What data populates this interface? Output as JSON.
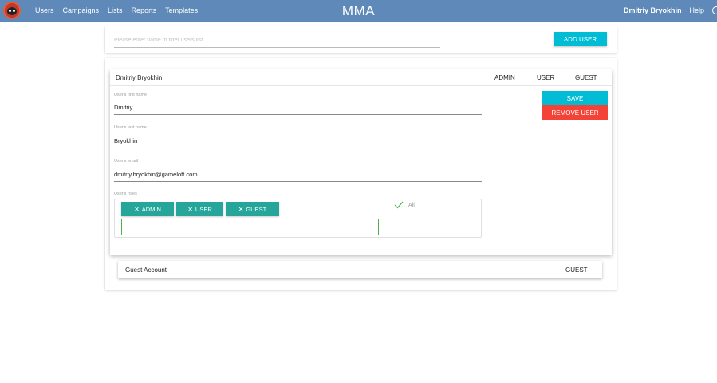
{
  "header": {
    "nav": [
      "Users",
      "Campaigns",
      "Lists",
      "Reports",
      "Templates"
    ],
    "title": "MMA",
    "user_name": "Dmitriy Bryokhin",
    "help": "Help",
    "bar_color": "#5e89b8"
  },
  "filter": {
    "placeholder": "Please enter name to filter users list",
    "add_user": "ADD USER"
  },
  "selected_user": {
    "name": "Dmitriy Bryokhin",
    "role_columns": [
      "ADMIN",
      "USER",
      "GUEST"
    ],
    "first_name_label": "User's first name",
    "first_name": "Dmitriy",
    "last_name_label": "User's last name",
    "last_name": "Bryokhin",
    "email_label": "User's email",
    "email": "dmitriy.bryokhin@gameloft.com",
    "roles_label": "User's roles",
    "roles": [
      "ADMIN",
      "USER",
      "GUEST"
    ],
    "all_label": "All",
    "save": "SAVE",
    "remove": "REMOVE USER"
  },
  "other_users": [
    {
      "name": "Guest Account",
      "roles": "GUEST"
    }
  ],
  "colors": {
    "accent": "#00bcd4",
    "danger": "#f44336",
    "chip": "#26a69a",
    "input_focus": "#4caf50"
  }
}
